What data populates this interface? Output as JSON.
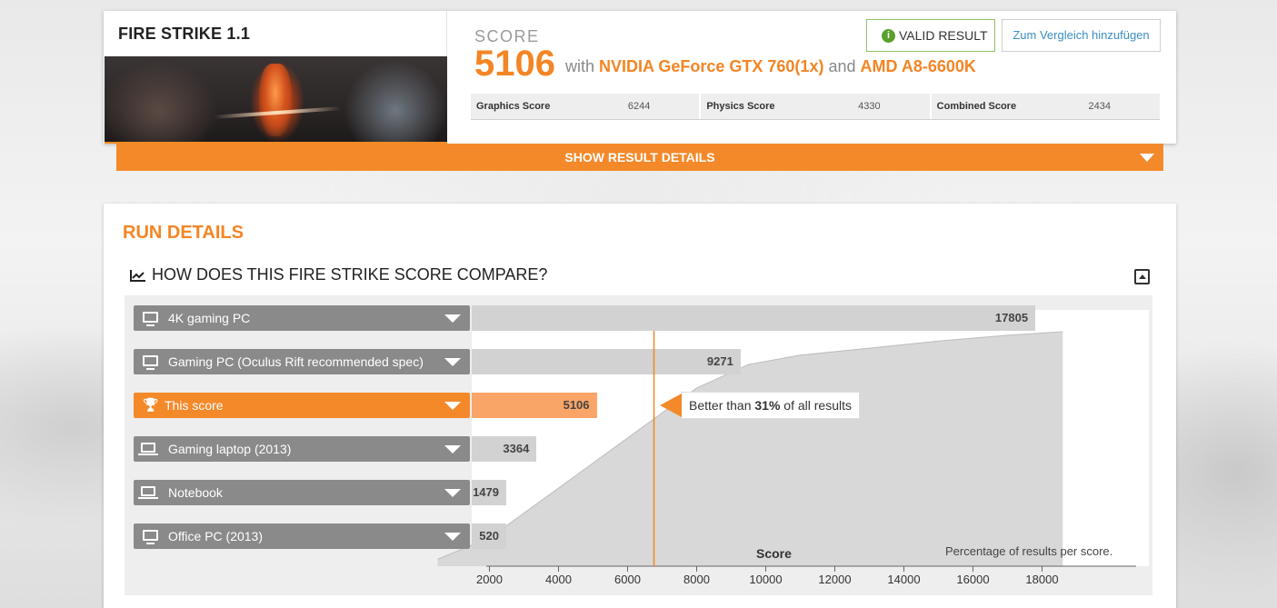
{
  "header": {
    "test_name": "FIRE STRIKE 1.1",
    "score_label": "SCORE",
    "score_value": "5106",
    "with_text": "with",
    "gpu": "NVIDIA GeForce GTX 760(1x)",
    "and_text": "and",
    "cpu": "AMD A8-6600K",
    "valid_label": "VALID RESULT",
    "compare_label": "Zum Vergleich hinzufügen",
    "subscores": [
      {
        "label": "Graphics Score",
        "value": "6244"
      },
      {
        "label": "Physics Score",
        "value": "4330"
      },
      {
        "label": "Combined Score",
        "value": "2434"
      }
    ],
    "show_details_label": "SHOW RESULT DETAILS"
  },
  "run_details": {
    "title": "RUN DETAILS",
    "compare_title": "HOW DOES THIS FIRE STRIKE SCORE COMPARE?"
  },
  "comparison": {
    "rows": [
      {
        "label": "4K gaming PC",
        "value": 17805,
        "icon": "desktop-icon",
        "active": false
      },
      {
        "label": "Gaming PC (Oculus Rift recommended spec)",
        "value": 9271,
        "icon": "desktop-icon",
        "active": false
      },
      {
        "label": "This score",
        "value": 5106,
        "icon": "trophy-icon",
        "active": true
      },
      {
        "label": "Gaming laptop (2013)",
        "value": 3364,
        "icon": "laptop-icon",
        "active": false
      },
      {
        "label": "Notebook",
        "value": 1479,
        "icon": "laptop-icon",
        "active": false
      },
      {
        "label": "Office PC (2013)",
        "value": 520,
        "icon": "desktop-icon",
        "active": false
      }
    ],
    "tooltip_prefix": "Better than ",
    "tooltip_percent": "31%",
    "tooltip_suffix": " of all results"
  },
  "chart_data": {
    "type": "area",
    "xlabel": "Score",
    "annotation": "Percentage of results per score.",
    "x_ticks": [
      "2000",
      "4000",
      "6000",
      "8000",
      "10000",
      "12000",
      "14000",
      "16000",
      "18000"
    ],
    "xlim": [
      0,
      19000
    ],
    "marker_score": 5106,
    "curve": [
      {
        "x": 500,
        "y": 0.03
      },
      {
        "x": 2000,
        "y": 0.12
      },
      {
        "x": 3500,
        "y": 0.28
      },
      {
        "x": 5000,
        "y": 0.44
      },
      {
        "x": 6500,
        "y": 0.6
      },
      {
        "x": 8000,
        "y": 0.76
      },
      {
        "x": 9500,
        "y": 0.86
      },
      {
        "x": 11000,
        "y": 0.9
      },
      {
        "x": 13000,
        "y": 0.93
      },
      {
        "x": 15000,
        "y": 0.96
      },
      {
        "x": 17000,
        "y": 0.985
      },
      {
        "x": 18600,
        "y": 1.0
      }
    ],
    "colors": {
      "accent": "#f48524",
      "area": "#d8d8d8",
      "bar": "#d2d2d2"
    }
  }
}
